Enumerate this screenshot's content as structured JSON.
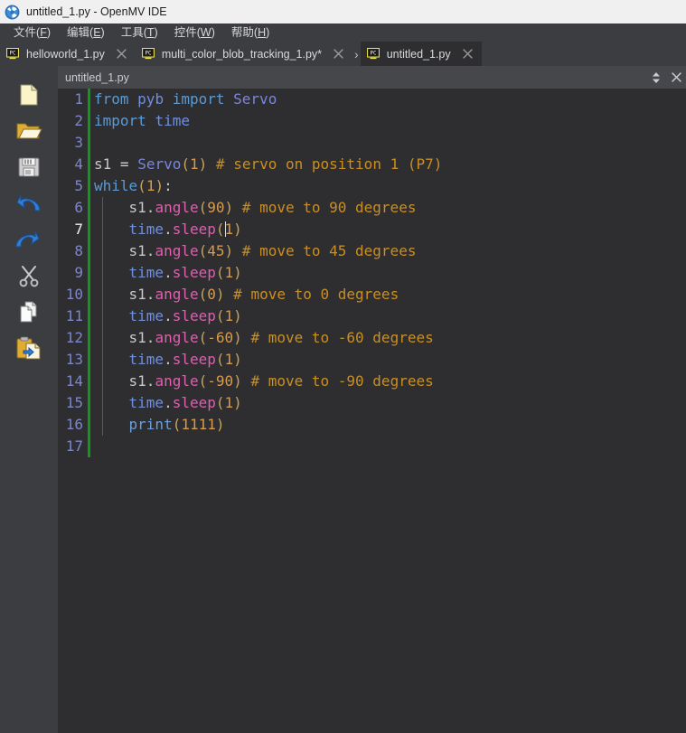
{
  "window": {
    "title": "untitled_1.py - OpenMV IDE",
    "app_icon": "openmv-aperture-icon"
  },
  "menubar": {
    "items": [
      {
        "label": "文件",
        "accel": "F",
        "name": "menu-file"
      },
      {
        "label": "编辑",
        "accel": "E",
        "name": "menu-edit"
      },
      {
        "label": "工具",
        "accel": "T",
        "name": "menu-tools"
      },
      {
        "label": "控件",
        "accel": "W",
        "name": "menu-widgets"
      },
      {
        "label": "帮助",
        "accel": "H",
        "name": "menu-help"
      }
    ]
  },
  "tabbar": {
    "tabs": [
      {
        "label": "helloworld_1.py",
        "active": false,
        "modified": false
      },
      {
        "label": "multi_color_blob_tracking_1.py*",
        "active": false,
        "modified": true
      },
      {
        "label": "untitled_1.py",
        "active": true,
        "modified": false
      }
    ],
    "overflow_glyph": "›",
    "close_glyph": "✕",
    "file_icon": "pc-monitor-icon"
  },
  "toolbar": {
    "buttons": [
      {
        "name": "new-file-button",
        "icon": "new-file-icon",
        "label": "New File"
      },
      {
        "name": "open-file-button",
        "icon": "open-folder-icon",
        "label": "Open File"
      },
      {
        "name": "save-file-button",
        "icon": "floppy-disk-save-icon",
        "label": "Save File"
      },
      {
        "name": "undo-button",
        "icon": "undo-arrow-icon",
        "label": "Undo"
      },
      {
        "name": "redo-button",
        "icon": "redo-arrow-icon",
        "label": "Redo"
      },
      {
        "name": "cut-button",
        "icon": "scissors-icon",
        "label": "Cut"
      },
      {
        "name": "copy-button",
        "icon": "copy-pages-icon",
        "label": "Copy"
      },
      {
        "name": "paste-button",
        "icon": "paste-clipboard-icon",
        "label": "Paste"
      }
    ]
  },
  "subtab": {
    "label": "untitled_1.py",
    "split_glyph": "⬍",
    "close_glyph": "✕"
  },
  "editor": {
    "current_line": 7,
    "total_lines": 17,
    "caret": {
      "line": 7,
      "column": 12
    },
    "lines": [
      {
        "n": 1,
        "modified": true,
        "indent_guides": 0
      },
      {
        "n": 2,
        "modified": true,
        "indent_guides": 0
      },
      {
        "n": 3,
        "modified": true,
        "indent_guides": 0
      },
      {
        "n": 4,
        "modified": true,
        "indent_guides": 0
      },
      {
        "n": 5,
        "modified": true,
        "indent_guides": 0
      },
      {
        "n": 6,
        "modified": true,
        "indent_guides": 1
      },
      {
        "n": 7,
        "modified": true,
        "indent_guides": 1
      },
      {
        "n": 8,
        "modified": true,
        "indent_guides": 1
      },
      {
        "n": 9,
        "modified": true,
        "indent_guides": 1
      },
      {
        "n": 10,
        "modified": true,
        "indent_guides": 1
      },
      {
        "n": 11,
        "modified": true,
        "indent_guides": 1
      },
      {
        "n": 12,
        "modified": true,
        "indent_guides": 1
      },
      {
        "n": 13,
        "modified": true,
        "indent_guides": 1
      },
      {
        "n": 14,
        "modified": true,
        "indent_guides": 1
      },
      {
        "n": 15,
        "modified": true,
        "indent_guides": 1
      },
      {
        "n": 16,
        "modified": true,
        "indent_guides": 1
      },
      {
        "n": 17,
        "modified": true,
        "indent_guides": 0
      }
    ],
    "source_plain": [
      "from pyb import Servo",
      "import time",
      "",
      "s1 = Servo(1) # servo on position 1 (P7)",
      "while(1):",
      "    s1.angle(90) # move to 90 degrees",
      "    time.sleep(1)",
      "    s1.angle(45) # move to 45 degrees",
      "    time.sleep(1)",
      "    s1.angle(0) # move to 0 degrees",
      "    time.sleep(1)",
      "    s1.angle(-60) # move to -60 degrees",
      "    time.sleep(1)",
      "    s1.angle(-90) # move to -90 degrees",
      "    time.sleep(1)",
      "    print(1111)",
      ""
    ]
  },
  "colors": {
    "titlebar_bg": "#f0f0f0",
    "chrome_bg": "#3b3d41",
    "editor_bg": "#2e2e31",
    "subtab_bg": "#45474b",
    "modified_marker": "#0e9a18",
    "linenumber": "#7e86c9",
    "comment": "#c98f22",
    "keyword": "#5a9bd5",
    "function": "#e05fae",
    "class": "#7b86d8",
    "number": "#d79b4c",
    "tab_icon_border": "#f2e74b"
  }
}
